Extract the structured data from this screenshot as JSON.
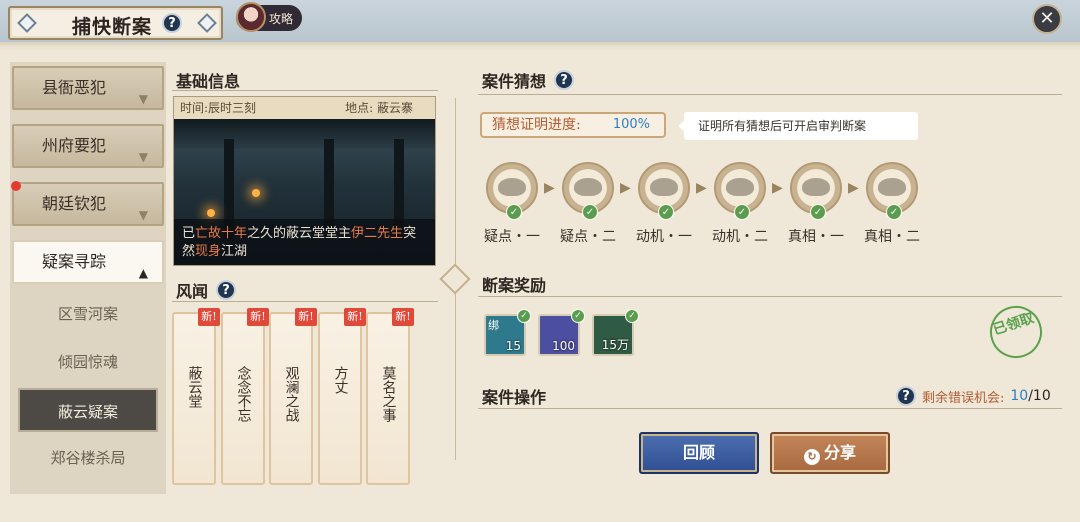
{
  "header": {
    "title": "捕快断案",
    "guide_label": "攻略"
  },
  "sidebar": {
    "items": [
      {
        "label": "县衙恶犯"
      },
      {
        "label": "州府要犯"
      },
      {
        "label": "朝廷钦犯"
      },
      {
        "label": "疑案寻踪"
      }
    ],
    "subitems": [
      {
        "label": "区雪河案"
      },
      {
        "label": "倾园惊魂"
      },
      {
        "label": "蔽云疑案"
      },
      {
        "label": "郑谷楼杀局"
      }
    ]
  },
  "basic_info": {
    "title": "基础信息",
    "time_label": "时间:辰时三刻",
    "place_label": "地点: 蔽云寨",
    "caption": {
      "p1": "已",
      "p2": "亡故十年",
      "p3": "之久的蔽云堂堂主",
      "p4": "伊二先生",
      "p5": "突然",
      "p6": "现身",
      "p7": "江湖"
    }
  },
  "rumors": {
    "title": "风闻",
    "new_badge": "新!",
    "items": [
      {
        "label": "蔽云堂"
      },
      {
        "label": "念念不忘"
      },
      {
        "label": "观澜之战"
      },
      {
        "label": "方丈"
      },
      {
        "label": "莫名之事"
      }
    ]
  },
  "guess": {
    "title": "案件猜想",
    "progress_label": "猜想证明进度:",
    "progress_value": "100%",
    "hint": "证明所有猜想后可开启审判断案",
    "clues": [
      {
        "label": "疑点・一"
      },
      {
        "label": "疑点・二"
      },
      {
        "label": "动机・一"
      },
      {
        "label": "动机・二"
      },
      {
        "label": "真相・一"
      },
      {
        "label": "真相・二"
      }
    ]
  },
  "rewards": {
    "title": "断案奖励",
    "items": [
      {
        "count": "15",
        "bind_tag": "绑",
        "color": "#2e7a8c"
      },
      {
        "count": "100",
        "bind_tag": "",
        "color": "#4c4fa0"
      },
      {
        "count": "15万",
        "bind_tag": "",
        "color": "#2f5a44"
      }
    ],
    "stamp": "已领取"
  },
  "operations": {
    "title": "案件操作",
    "mistakes_label": "剩余错误机会:",
    "mistakes_left": "10",
    "mistakes_total": "/10",
    "review_button": "回顾",
    "share_button": "分享"
  }
}
